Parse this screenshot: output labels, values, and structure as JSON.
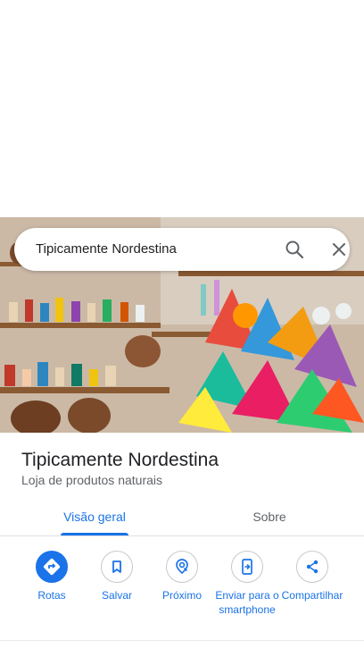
{
  "search": {
    "query": "Tipicamente Nordestina",
    "search_icon": "search-icon",
    "close_icon": "close-icon"
  },
  "place": {
    "name": "Tipicamente Nordestina",
    "category": "Loja de produtos naturais",
    "photo_description": "shop-interior-photo"
  },
  "tabs": [
    {
      "label": "Visão geral",
      "active": true
    },
    {
      "label": "Sobre",
      "active": false
    }
  ],
  "actions": [
    {
      "label": "Rotas",
      "icon": "directions-icon",
      "primary": true
    },
    {
      "label": "Salvar",
      "icon": "bookmark-icon",
      "primary": false
    },
    {
      "label": "Próximo",
      "icon": "nearby-icon",
      "primary": false
    },
    {
      "label": "Enviar para o smartphone",
      "icon": "send-to-phone-icon",
      "primary": false
    },
    {
      "label": "Compartilhar",
      "icon": "share-icon",
      "primary": false
    }
  ],
  "colors": {
    "accent": "#1a73e8",
    "text_primary": "#202124",
    "text_secondary": "#5f6368"
  }
}
